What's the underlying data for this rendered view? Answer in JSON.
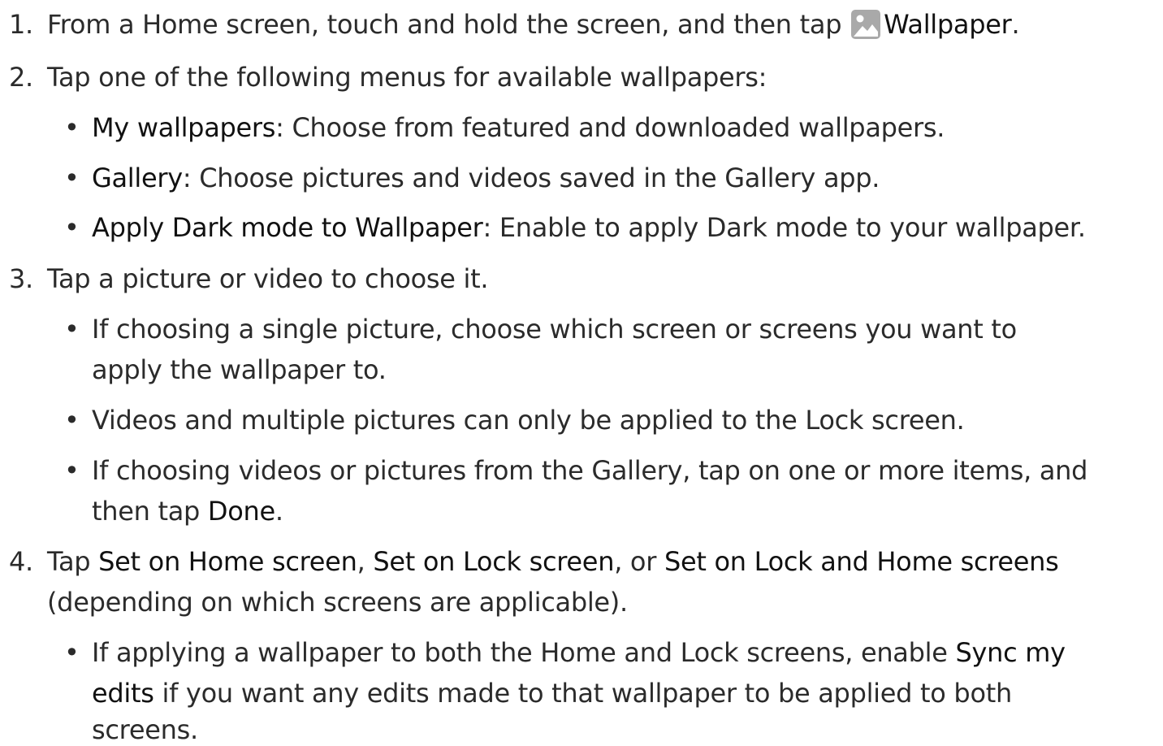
{
  "steps": [
    {
      "number": "1.",
      "t1": "From a Home screen, touch and hold the screen, and then tap ",
      "icon": "wallpaper-icon",
      "b1": "Wallpaper",
      "t2": "."
    },
    {
      "number": "2.",
      "text": "Tap one of the following menus for available wallpapers:",
      "bullets": [
        {
          "bold": "My wallpapers",
          "text": ": Choose from featured and downloaded wallpapers."
        },
        {
          "bold": "Gallery",
          "text": ": Choose pictures and videos saved in the Gallery app."
        },
        {
          "bold": "Apply Dark mode to Wallpaper",
          "text": ": Enable to apply Dark mode to your wallpaper."
        }
      ]
    },
    {
      "number": "3.",
      "text": "Tap a picture or video to choose it.",
      "bullets": [
        {
          "line1": "If choosing a single picture, choose which screen or screens you want to",
          "line2": "apply the wallpaper to."
        },
        {
          "line1": "Videos and multiple pictures can only be applied to the Lock screen."
        },
        {
          "line1": "If choosing videos or pictures from the Gallery, tap on one or more items, and",
          "line2_pre": "then tap ",
          "line2_bold": "Done",
          "line2_post": "."
        }
      ]
    },
    {
      "number": "4.",
      "t1": "Tap ",
      "b1": "Set on Home screen",
      "t2": ", ",
      "b2": "Set on Lock screen",
      "t3": ", or ",
      "b3": "Set on Lock and Home screens",
      "line2": "(depending on which screens are applicable).",
      "bullet": {
        "line1_pre": "If applying a wallpaper to both the Home and Lock screens, enable ",
        "line1_bold": "Sync my",
        "line2_bold": "edits",
        "line2_post": " if you want any edits made to that wallpaper to be applied to both",
        "line3": "screens."
      }
    }
  ],
  "bullet_glyph": "•",
  "colors": {
    "text": "#2b2b2b",
    "bold": "#111111",
    "icon_bg": "#a9a9a9"
  }
}
